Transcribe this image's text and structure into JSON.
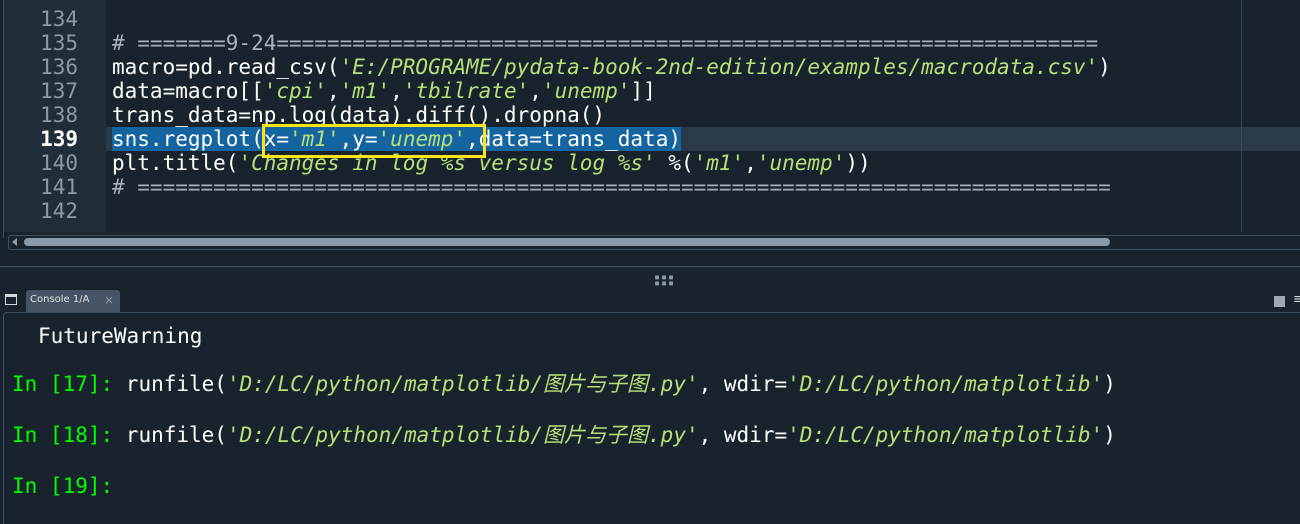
{
  "editor": {
    "line_numbers": [
      "134",
      "135",
      "136",
      "137",
      "138",
      "139",
      "140",
      "141",
      "142"
    ],
    "current_line": "139",
    "lines": {
      "l135": "# =======9-24=================================================================",
      "l136": {
        "pre": "macro=pd.read_csv(",
        "str": "'E:/PROGRAME/pydata-book-2nd-edition/examples/macrodata.csv'",
        "post": ")"
      },
      "l137": {
        "p1": "data=macro[[",
        "s1": "'cpi'",
        "c1": ",",
        "s2": "'m1'",
        "c2": ",",
        "s3": "'tbilrate'",
        "c3": ",",
        "s4": "'unemp'",
        "p2": "]]"
      },
      "l138": "trans_data=np.log(data).diff().dropna()",
      "l139": {
        "p1": "sns.regplot(x=",
        "s1": "'m1'",
        "p2": ",y=",
        "s2": "'unemp'",
        "p3": ",data=trans_data)"
      },
      "l140": {
        "p1": "plt.title(",
        "s1": "'Changes in log %s versus log %s'",
        "p2": " %(",
        "s2": "'m1'",
        "p3": ",",
        "s3": "'unemp'",
        "p4": "))"
      },
      "l141": "# ============================================================================="
    }
  },
  "console": {
    "tab_label": "Console 1/A",
    "close_glyph": "×",
    "warning": "FutureWarning",
    "in17": {
      "prompt": "In [17]:",
      "cmd": " runfile(",
      "arg1": "'D:/LC/python/matplotlib/图片与子图.py'",
      "mid": ", wdir=",
      "arg2": "'D:/LC/python/matplotlib'",
      "end": ")"
    },
    "in18": {
      "prompt": "In [18]:",
      "cmd": " runfile(",
      "arg1": "'D:/LC/python/matplotlib/图片与子图.py'",
      "mid": ", wdir=",
      "arg2": "'D:/LC/python/matplotlib'",
      "end": ")"
    },
    "in19": {
      "prompt": "In [19]:"
    }
  },
  "colors": {
    "background": "#19232d",
    "string": "#b5e077",
    "prompt": "#00ff00",
    "selection": "#1464a0",
    "highlight_box": "#ffe318"
  }
}
